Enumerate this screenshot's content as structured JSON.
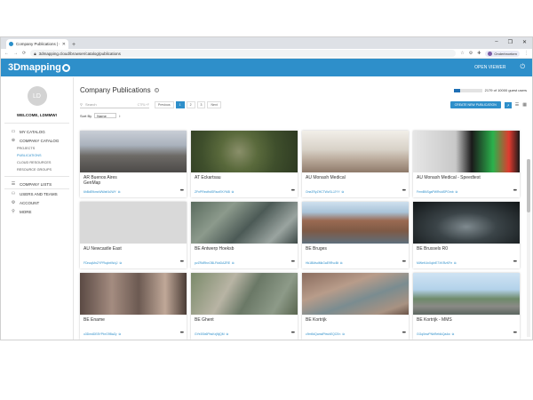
{
  "browser": {
    "tab_title": "Company Publications | Compa",
    "url": "3dmapping.cloud/browser/catalog/publications",
    "profile": "Onderbroeken"
  },
  "app": {
    "logo": "3Dmapping",
    "open_viewer": "OPEN VIEWER"
  },
  "sidebar": {
    "avatar": "LD",
    "welcome": "WELCOME, LDMMW!",
    "items": [
      {
        "label": "MY CATALOG",
        "icon": "folder-icon"
      },
      {
        "label": "COMPANY CATALOG",
        "icon": "globe-icon"
      },
      {
        "label": "PROJECTS"
      },
      {
        "label": "PUBLICATIONS"
      },
      {
        "label": "CLOUD RESOURCES"
      },
      {
        "label": "RESOURCE GROUPS"
      },
      {
        "label": "COMPANY LISTS",
        "icon": "list-icon"
      },
      {
        "label": "USERS AND TEAMS",
        "icon": "users-icon"
      },
      {
        "label": "ACCOUNT",
        "icon": "account-icon"
      },
      {
        "label": "MORE",
        "icon": "more-icon"
      }
    ]
  },
  "main": {
    "title": "Company Publications",
    "quota": {
      "text": "2179 of 10000 guest users",
      "fraction": 0.22
    },
    "search_placeholder": "Search",
    "search_hint": "CTRL+F",
    "pager": {
      "prev": "Previous",
      "pages": [
        "1",
        "2",
        "3"
      ],
      "next": "Next"
    },
    "create_btn": "CREATE NEW PUBLICATION",
    "sort_label": "Sort By",
    "sort_value": "Name"
  },
  "cards": [
    {
      "name": "AR Buenos Aires",
      "sub": "GenMap",
      "id": "6hBdEfkmcWWaKbJWY"
    },
    {
      "name": "AT Eckartsau",
      "sub": "",
      "id": "ZFnPRecfhdSRscrEKYM8"
    },
    {
      "name": "AU Monash Medical",
      "sub": "",
      "id": "OneZRyZHCTWzSLJJYY"
    },
    {
      "name": "AU Monash Medical - Speedtest",
      "sub": "",
      "id": "FemBNSgaPWRvidSPGmb"
    },
    {
      "name": "AU Newcastle East",
      "sub": "",
      "id": "FDnoqMnZYPFkqbrtWxjJ"
    },
    {
      "name": "BE Antwerp Hoeksb",
      "sub": "",
      "id": "pvZRdRhnOBLFkbDAZRE"
    },
    {
      "name": "BE Bruges",
      "sub": "",
      "id": "Hk1BMsdMkGaE9RvcBt"
    },
    {
      "name": "BE Brussels R0",
      "sub": "",
      "id": "MWeK4nXqbrE7XKRzKFe"
    },
    {
      "name": "BE Ename",
      "sub": "",
      "id": "o3DmdDE8YPbrG9BaZy"
    },
    {
      "name": "BE Ghent",
      "sub": "",
      "id": "GYe3Sb6PbsKxjNjQM"
    },
    {
      "name": "BE Kortrijk",
      "sub": "",
      "id": "c9m9dQamdPbwhEQCEn"
    },
    {
      "name": "BE Kortrijk - MMS",
      "sub": "",
      "id": "GGq0ewPNbRefdkQa4w"
    }
  ]
}
